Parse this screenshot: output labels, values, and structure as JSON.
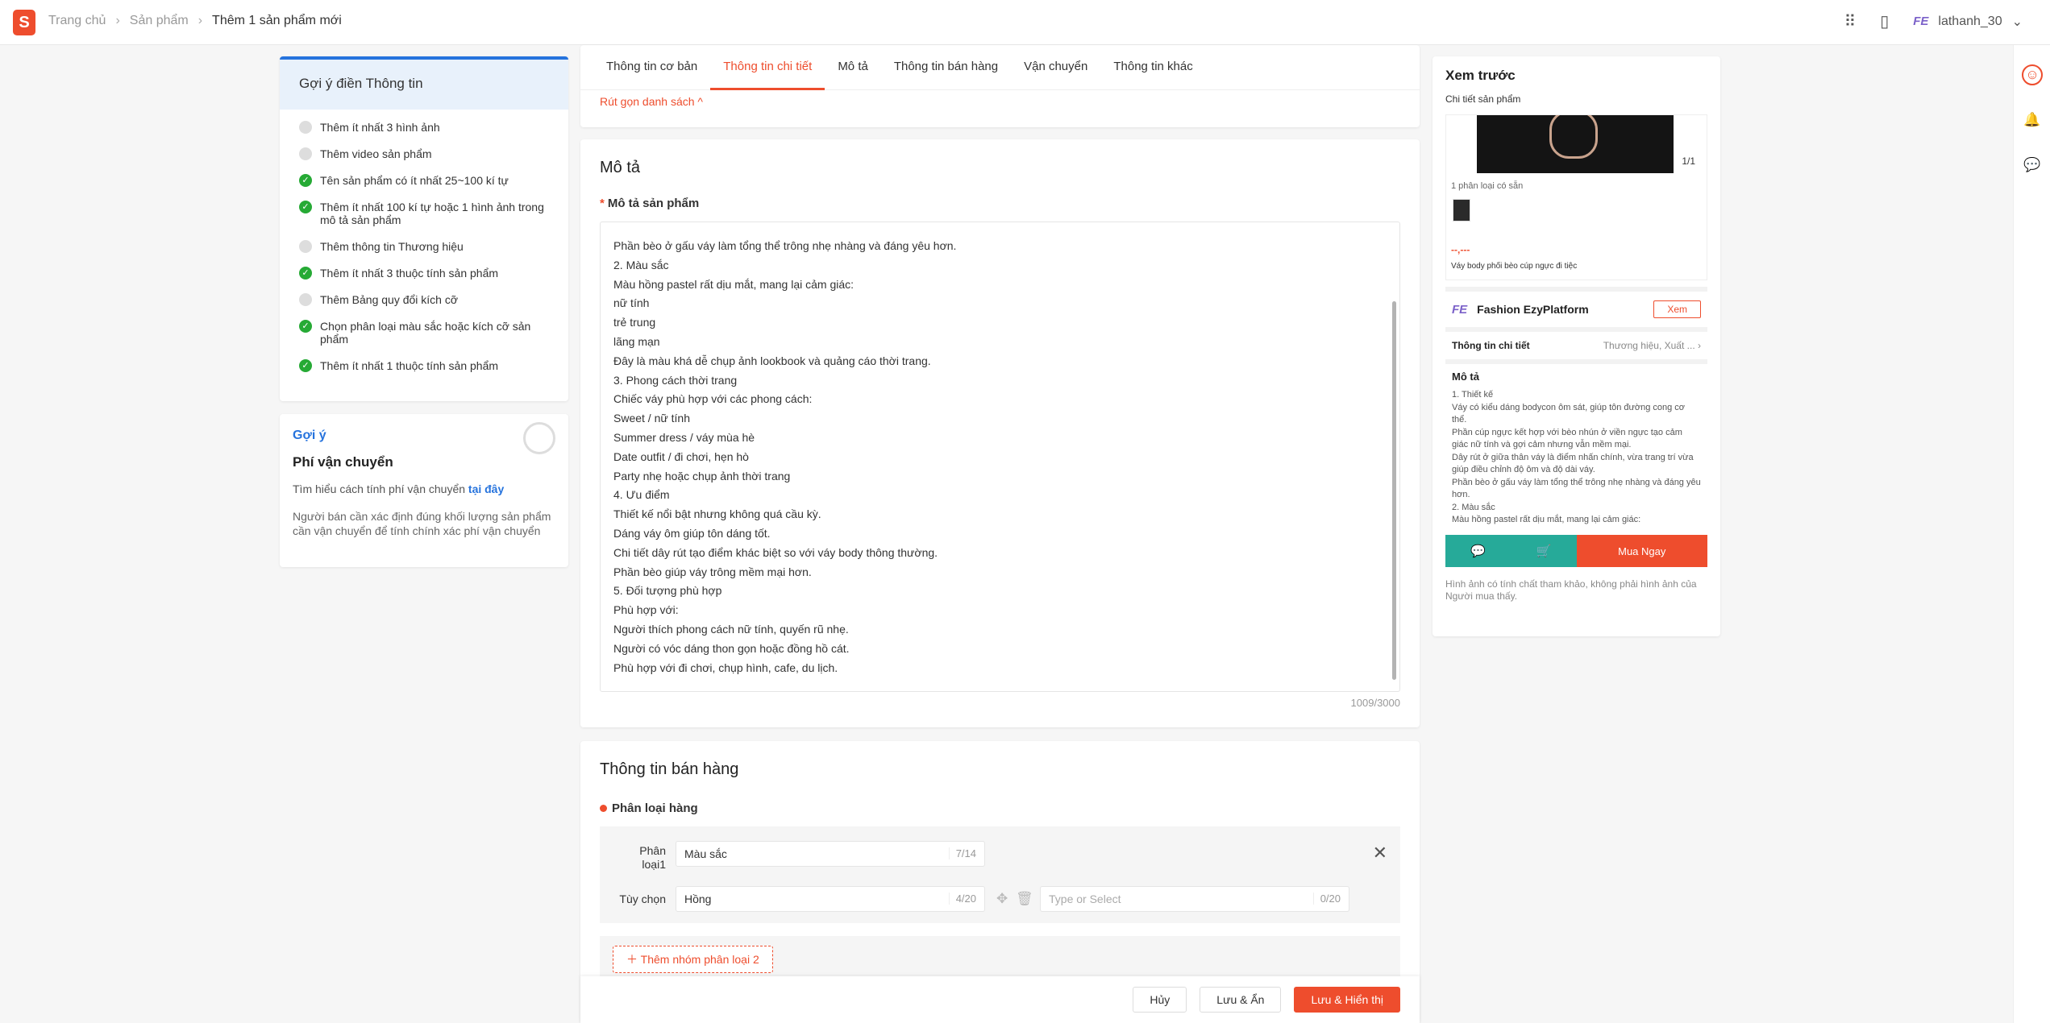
{
  "header": {
    "logo": "S",
    "breadcrumb": [
      "Trang chủ",
      "Sản phẩm",
      "Thêm 1 sản phẩm mới"
    ],
    "brand_mark": "FE",
    "username": "lathanh_30"
  },
  "hints": {
    "title": "Gợi ý điền Thông tin",
    "items": [
      {
        "label": "Thêm ít nhất 3 hình ảnh",
        "done": false
      },
      {
        "label": "Thêm video sản phẩm",
        "done": false
      },
      {
        "label": "Tên sản phẩm có ít nhất 25~100 kí tự",
        "done": true
      },
      {
        "label": "Thêm ít nhất 100 kí tự hoặc 1 hình ảnh trong mô tả sản phẩm",
        "done": true
      },
      {
        "label": "Thêm thông tin Thương hiệu",
        "done": false
      },
      {
        "label": "Thêm ít nhất 3 thuộc tính sản phẩm",
        "done": true
      },
      {
        "label": "Thêm Bảng quy đổi kích cỡ",
        "done": false
      },
      {
        "label": "Chọn phân loại màu sắc hoặc kích cỡ sản phẩm",
        "done": true
      },
      {
        "label": "Thêm ít nhất 1 thuộc tính sản phẩm",
        "done": true
      }
    ]
  },
  "tip": {
    "title": "Gợi ý",
    "subtitle": "Phí vận chuyển",
    "text": "Tìm hiểu cách tính phí vận chuyển",
    "link": "tại đây",
    "text2": "Người bán cần xác định đúng khối lượng sản phẩm cần vận chuyển để tính chính xác phí vận chuyển"
  },
  "tabs": [
    "Thông tin cơ bản",
    "Thông tin chi tiết",
    "Mô tả",
    "Thông tin bán hàng",
    "Vận chuyển",
    "Thông tin khác"
  ],
  "active_tab": 1,
  "collapse_label": "Rút gọn danh sách ^",
  "description": {
    "section_title": "Mô tả",
    "field_label": "Mô tả sản phẩm",
    "lines": [
      "Phần bèo ở gấu váy làm tổng thể trông nhẹ nhàng và đáng yêu hơn.",
      "2. Màu sắc",
      "Màu hồng pastel rất dịu mắt, mang lại cảm giác:",
      "nữ tính",
      "trẻ trung",
      "lãng mạn",
      "Đây là màu khá dễ chụp ảnh lookbook và quảng cáo thời trang.",
      "3. Phong cách thời trang",
      "Chiếc váy phù hợp với các phong cách:",
      "Sweet / nữ tính",
      "Summer dress / váy mùa hè",
      "Date outfit / đi chơi, hẹn hò",
      "Party nhẹ hoặc chụp ảnh thời trang",
      "4. Ưu điểm",
      "Thiết kế nổi bật nhưng không quá cầu kỳ.",
      "Dáng váy ôm giúp tôn dáng tốt.",
      "Chi tiết dây rút tạo điểm khác biệt so với váy body thông thường.",
      "Phần bèo giúp váy trông mềm mại hơn.",
      "5. Đối tượng phù hợp",
      "Phù hợp với:",
      "Người thích phong cách nữ tính, quyến rũ nhẹ.",
      "Người có vóc dáng thon gọn hoặc đồng hồ cát.",
      "Phù hợp với đi chơi, chụp hình, cafe, du lịch."
    ],
    "char_count": "1009/3000"
  },
  "sales": {
    "section_title": "Thông tin bán hàng",
    "variation_label": "Phân loại hàng",
    "group1_label": "Phân loại1",
    "group1_name": "Màu sắc",
    "group1_count": "7/14",
    "option_label": "Tùy chọn",
    "option1": "Hồng",
    "option1_count": "4/20",
    "option_placeholder": "Type or Select",
    "option_placeholder_count": "0/20",
    "add_group": "Thêm nhóm phân loại 2"
  },
  "footer": {
    "cancel": "Hủy",
    "save_hide": "Lưu & Ẩn",
    "save_show": "Lưu & Hiển thị"
  },
  "preview": {
    "title": "Xem trước",
    "subtitle": "Chi tiết sản phẩm",
    "img_count": "1/1",
    "variants_available": "1 phân loại có sẵn",
    "price": "--,---",
    "product_name": "Váy body phối bèo cúp ngực đi tiệc",
    "shop_logo": "FE",
    "shop_name": "Fashion EzyPlatform",
    "view_btn": "Xem",
    "detail_label": "Thông tin chi tiết",
    "detail_value": "Thương hiệu, Xuất ...",
    "desc_title": "Mô tả",
    "desc_lines": [
      "1. Thiết kế",
      "Váy có kiểu dáng bodycon ôm sát, giúp tôn đường cong cơ thể.",
      "Phần cúp ngực kết hợp với bèo nhún ở viền ngực tạo cảm giác nữ tính và gợi cảm nhưng vẫn mềm mại.",
      "Dây rút ở giữa thân váy là điểm nhấn chính, vừa trang trí vừa giúp điều chỉnh độ ôm và độ dài váy.",
      "Phần bèo ở gấu váy làm tổng thể trông nhẹ nhàng và đáng yêu hơn.",
      "2. Màu sắc",
      "Màu hồng pastel rất dịu mắt, mang lại cảm giác:"
    ],
    "buy_now": "Mua Ngay",
    "disclaimer": "Hình ảnh có tính chất tham khảo, không phải hình ảnh của Người mua thấy."
  },
  "colors": {
    "accent": "#ee4d2d",
    "blue": "#2673dd",
    "green": "#26aa35",
    "teal": "#26aa99"
  }
}
